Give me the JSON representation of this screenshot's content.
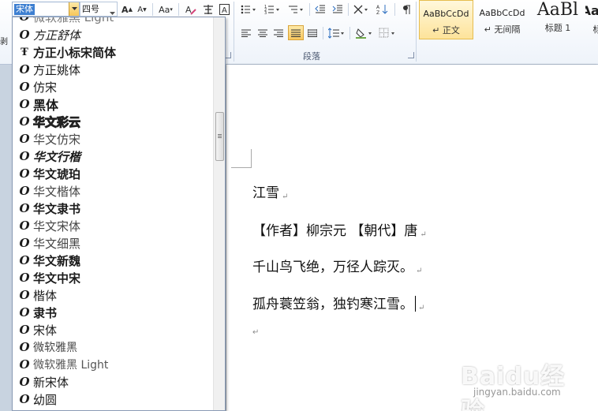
{
  "toolbar": {
    "font_name": "宋体",
    "font_size": "四号",
    "change_case_label": "Aa",
    "group_label": "段落",
    "left_fragment": "剥"
  },
  "styles": [
    {
      "sample": "AaBbCcDd",
      "name": "↵ 正文"
    },
    {
      "sample": "AaBbCcDd",
      "name": "↵ 无间隔"
    },
    {
      "sample": "AaBl",
      "name": "标题 1"
    },
    {
      "sample": "AaBl",
      "name": "标"
    }
  ],
  "font_list": [
    {
      "label": "方正舒体",
      "icon": "opentype-icon"
    },
    {
      "label": "方正小标宋简体",
      "icon": "truetype-icon"
    },
    {
      "label": "方正姚体",
      "icon": "opentype-icon"
    },
    {
      "label": "仿宋",
      "icon": "opentype-icon"
    },
    {
      "label": "黑体",
      "icon": "opentype-icon"
    },
    {
      "label": "华文彩云",
      "icon": "opentype-icon"
    },
    {
      "label": "华文仿宋",
      "icon": "opentype-icon"
    },
    {
      "label": "华文行楷",
      "icon": "opentype-icon"
    },
    {
      "label": "华文琥珀",
      "icon": "opentype-icon"
    },
    {
      "label": "华文楷体",
      "icon": "opentype-icon"
    },
    {
      "label": "华文隶书",
      "icon": "opentype-icon"
    },
    {
      "label": "华文宋体",
      "icon": "opentype-icon"
    },
    {
      "label": "华文细黑",
      "icon": "opentype-icon"
    },
    {
      "label": "华文新魏",
      "icon": "opentype-icon"
    },
    {
      "label": "华文中宋",
      "icon": "opentype-icon"
    },
    {
      "label": "楷体",
      "icon": "opentype-icon"
    },
    {
      "label": "隶书",
      "icon": "opentype-icon"
    },
    {
      "label": "宋体",
      "icon": "opentype-icon"
    },
    {
      "label": "微软雅黑",
      "icon": "opentype-icon"
    },
    {
      "label": "微软雅黑 Light",
      "icon": "opentype-icon"
    },
    {
      "label": "新宋体",
      "icon": "opentype-icon"
    },
    {
      "label": "幼圆",
      "icon": "opentype-icon"
    }
  ],
  "font_list_top_partial": "微软雅黑 Light",
  "document": {
    "lines": [
      "江雪",
      "【作者】柳宗元 【朝代】唐",
      "千山鸟飞绝，万径人踪灭。",
      "孤舟蓑笠翁，独钓寒江雪。"
    ],
    "paragraph_mark": "↵"
  },
  "watermark": {
    "text": "Baidu经验",
    "url": "jingyan.baidu.com"
  }
}
